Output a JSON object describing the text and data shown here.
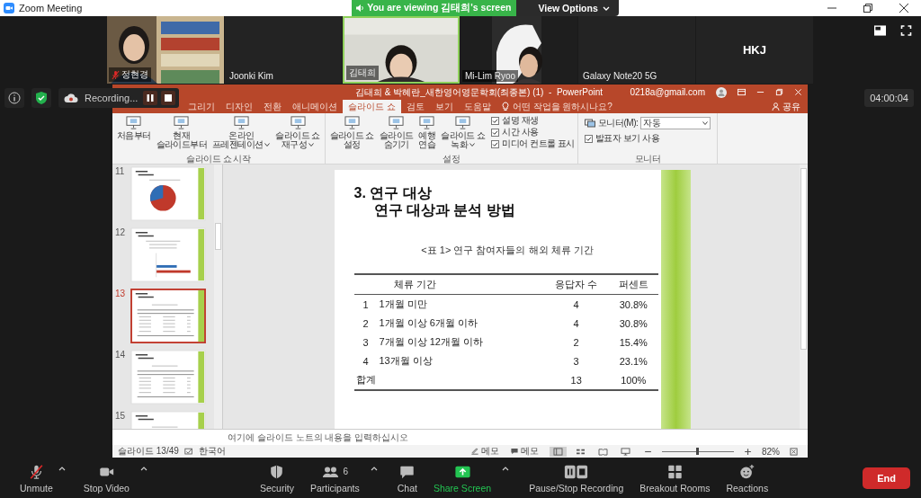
{
  "window": {
    "title": "Zoom Meeting"
  },
  "banner": {
    "text": "You are viewing 김태희's screen",
    "view_options": "View Options"
  },
  "participants": [
    {
      "name": "정현경",
      "kind": "video",
      "muted": true,
      "speaking": false
    },
    {
      "name": "Joonki Kim",
      "kind": "name",
      "muted": false,
      "speaking": false
    },
    {
      "name": "김태희",
      "kind": "video",
      "muted": false,
      "speaking": true
    },
    {
      "name": "Mi-Lim Ryoo",
      "kind": "video",
      "muted": false,
      "speaking": false
    },
    {
      "name": "Galaxy Note20 5G",
      "kind": "name",
      "muted": false,
      "speaking": false
    },
    {
      "name": "HKJ",
      "kind": "initials",
      "muted": false,
      "speaking": false
    }
  ],
  "recording": {
    "label": "Recording..."
  },
  "timer": "04:00:04",
  "powerpoint": {
    "title": "김태희 & 박혜란_새한영어영문학회(최종본) (1)  -  PowerPoint",
    "account": "0218a@gmail.com",
    "tabs": [
      {
        "label": "그리기",
        "selected": false
      },
      {
        "label": "디자인",
        "selected": false
      },
      {
        "label": "전환",
        "selected": false
      },
      {
        "label": "애니메이션",
        "selected": false
      },
      {
        "label": "슬라이드 쇼",
        "selected": true
      },
      {
        "label": "검토",
        "selected": false
      },
      {
        "label": "보기",
        "selected": false
      },
      {
        "label": "도움말",
        "selected": false
      }
    ],
    "tell_me": "어떤 작업을 원하시나요?",
    "share": "공유",
    "ribbon_groups": [
      {
        "label": "슬라이드 쇼 시작",
        "items": [
          {
            "kind": "button",
            "label": "처음부터",
            "dropdown": false
          },
          {
            "kind": "button",
            "label": "현재\n슬라이드부터",
            "dropdown": false
          },
          {
            "kind": "button",
            "label": "온라인\n프레젠테이션",
            "dropdown": true
          },
          {
            "kind": "button",
            "label": "슬라이드 쇼\n재구성",
            "dropdown": true
          }
        ]
      },
      {
        "label": "설정",
        "items": [
          {
            "kind": "button",
            "label": "슬라이드 쇼\n설정",
            "dropdown": false
          },
          {
            "kind": "button",
            "label": "슬라이드\n숨기기",
            "dropdown": false
          },
          {
            "kind": "button",
            "label": "예행\n연습",
            "dropdown": false
          },
          {
            "kind": "button",
            "label": "슬라이드 쇼\n녹화",
            "dropdown": true
          },
          {
            "kind": "checks",
            "checks": [
              {
                "label": "설명 재생",
                "checked": true
              },
              {
                "label": "시간 사용",
                "checked": true
              },
              {
                "label": "미디어 컨트롤 표시",
                "checked": true
              }
            ]
          }
        ]
      },
      {
        "label": "모니터",
        "items": [
          {
            "kind": "monitor",
            "label": "모니터(M):",
            "value": "자동",
            "checks": [
              {
                "label": "발표자 보기 사용",
                "checked": true
              }
            ]
          }
        ]
      }
    ],
    "slides": [
      {
        "number": "11",
        "kind": "pie",
        "selected": false
      },
      {
        "number": "12",
        "kind": "bar",
        "selected": false
      },
      {
        "number": "13",
        "kind": "table",
        "selected": true
      },
      {
        "number": "14",
        "kind": "table",
        "selected": false
      },
      {
        "number": "15",
        "kind": "table",
        "selected": false
      }
    ],
    "current_slide": {
      "heading": "3. 연구 대상",
      "subheading": "연구 대상과 분석 방법",
      "caption": "<표 1> 연구 참여자들의 해외 체류 기간",
      "columns": [
        "체류 기간",
        "응답자 수",
        "퍼센트"
      ],
      "rows": [
        {
          "number": "1",
          "period": "1개월 미만",
          "count": "4",
          "percent": "30.8%"
        },
        {
          "number": "2",
          "period": "1개월 이상 6개월 이하",
          "count": "4",
          "percent": "30.8%"
        },
        {
          "number": "3",
          "period": "7개월 이상 12개월 이하",
          "count": "2",
          "percent": "15.4%"
        },
        {
          "number": "4",
          "period": "13개월 이상",
          "count": "3",
          "percent": "23.1%"
        }
      ],
      "total": {
        "label": "합계",
        "count": "13",
        "percent": "100%"
      }
    },
    "notes_placeholder": "여기에 슬라이드 노트의 내용을 입력하십시오",
    "status": {
      "slide": "슬라이드 13/49",
      "language": "한국어",
      "notes": "메모",
      "comments": "메모",
      "zoom": "82%",
      "zoom_slider": {
        "level": 0.5
      }
    }
  },
  "toolbar": [
    {
      "label": "Unmute",
      "kind": "mic",
      "menu": true
    },
    {
      "label": "Stop Video",
      "kind": "video",
      "menu": true
    },
    {
      "label": "Security",
      "kind": "shield",
      "menu": false
    },
    {
      "label": "Participants",
      "kind": "people",
      "menu": true,
      "count": "6"
    },
    {
      "label": "Chat",
      "kind": "chat",
      "menu": false
    },
    {
      "label": "Share Screen",
      "kind": "share",
      "menu": true
    },
    {
      "label": "Pause/Stop Recording",
      "kind": "record",
      "menu": false
    },
    {
      "label": "Breakout Rooms",
      "kind": "rooms",
      "menu": false
    },
    {
      "label": "Reactions",
      "kind": "reactions",
      "menu": false
    }
  ],
  "end_button": "End"
}
